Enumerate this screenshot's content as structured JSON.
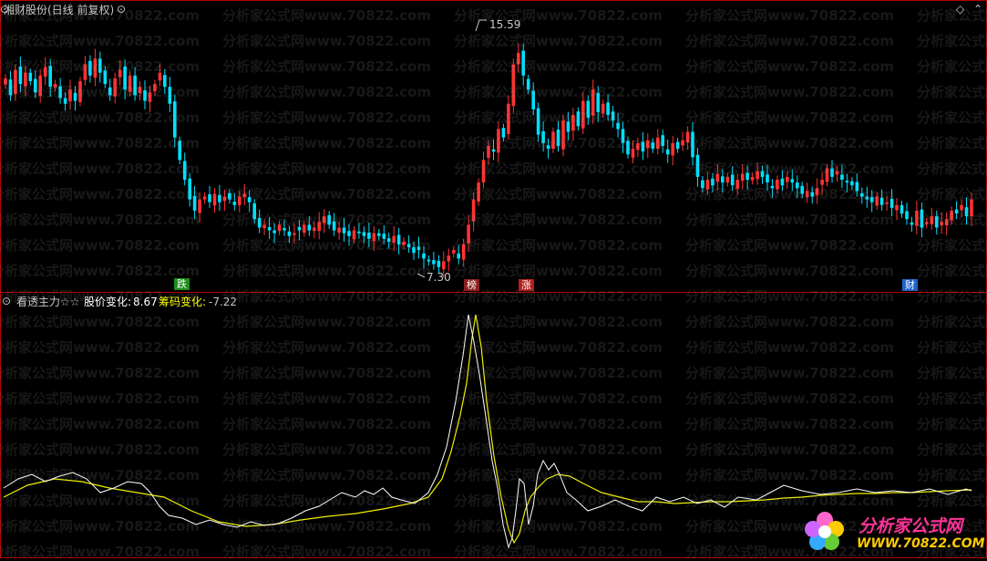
{
  "colors": {
    "up": "#ff3232",
    "down": "#00e0ff",
    "border": "#b40000",
    "white_line": "#ffffff",
    "yellow_line": "#f0f000",
    "label_yellow": "#ffff00",
    "label_gray": "#c8c8c8"
  },
  "main_panel": {
    "title": "湘财股份(日线 前复权)",
    "menu_icon": "circle-chevron-icon",
    "diamond_icon": "diamond-icon",
    "high_label": "15.59",
    "low_label": "7.30",
    "badges": [
      {
        "text": "跌",
        "bg": "#1e8c1e",
        "fg": "#ffffff"
      },
      {
        "text": "榜",
        "bg": "#8c1e1e",
        "fg": "#ffffff"
      },
      {
        "text": "涨",
        "bg": "#b41e1e",
        "fg": "#ffffff"
      },
      {
        "text": "财",
        "bg": "#1e64c8",
        "fg": "#ffffff"
      }
    ]
  },
  "indicator_panel": {
    "name": "看透主力☆☆",
    "field1_label": "股价变化:",
    "field1_value": "8.67",
    "field2_label": "筹码变化:",
    "field2_value": "-7.22"
  },
  "watermark": {
    "text": "分析家公式网www.70822.com"
  },
  "logo": {
    "title": "分析家公式网",
    "url": "WWW.70822.COM"
  },
  "chart_data": [
    {
      "type": "candlestick",
      "title": "湘财股份(日线 前复权)",
      "high_marker": 15.59,
      "low_marker": 7.3,
      "ylim": [
        7.0,
        16.3
      ],
      "close": [
        14.1,
        13.5,
        14.4,
        13.9,
        14.3,
        14.0,
        13.6,
        14.2,
        14.5,
        13.8,
        13.9,
        13.4,
        13.2,
        13.7,
        13.3,
        14.0,
        14.6,
        14.2,
        14.8,
        14.3,
        13.9,
        13.5,
        14.1,
        14.4,
        13.7,
        14.2,
        13.5,
        13.8,
        13.3,
        13.6,
        13.9,
        14.3,
        13.8,
        13.2,
        12.0,
        11.2,
        10.5,
        9.8,
        9.4,
        9.8,
        9.9,
        9.7,
        10.0,
        9.7,
        9.9,
        9.8,
        9.6,
        9.9,
        10.0,
        9.7,
        9.1,
        8.8,
        8.9,
        8.7,
        8.6,
        8.9,
        8.7,
        8.5,
        8.6,
        8.7,
        8.9,
        8.7,
        8.8,
        9.0,
        9.2,
        8.9,
        8.7,
        8.8,
        8.6,
        8.5,
        8.7,
        8.6,
        8.5,
        8.4,
        8.6,
        8.5,
        8.4,
        8.3,
        8.5,
        8.2,
        8.3,
        8.1,
        7.9,
        8.0,
        7.7,
        7.6,
        7.5,
        7.4,
        7.6,
        7.8,
        8.0,
        7.7,
        8.2,
        8.9,
        9.8,
        10.4,
        11.2,
        11.7,
        11.5,
        12.3,
        12.0,
        13.2,
        14.6,
        15.0,
        14.2,
        13.7,
        13.0,
        12.1,
        11.8,
        11.6,
        12.2,
        11.7,
        12.6,
        12.2,
        12.8,
        12.4,
        13.3,
        12.7,
        13.7,
        12.9,
        13.2,
        12.8,
        12.6,
        12.3,
        11.8,
        11.4,
        11.6,
        11.8,
        11.5,
        11.9,
        11.6,
        12.0,
        11.7,
        11.4,
        11.8,
        11.6,
        11.9,
        12.2,
        11.3,
        10.6,
        10.2,
        10.5,
        10.3,
        10.7,
        10.4,
        10.6,
        10.3,
        10.5,
        10.7,
        10.5,
        10.6,
        10.8,
        10.6,
        10.4,
        10.2,
        10.5,
        10.3,
        10.6,
        10.4,
        10.2,
        10.0,
        10.1,
        9.9,
        10.2,
        10.5,
        10.9,
        10.6,
        10.8,
        10.5,
        10.4,
        10.3,
        10.1,
        9.9,
        9.8,
        9.7,
        9.9,
        9.6,
        9.7,
        9.5,
        9.6,
        9.3,
        9.1,
        8.9,
        9.4,
        8.8,
        9.0,
        9.2,
        8.8,
        9.0,
        9.1,
        9.4,
        9.3,
        9.6,
        9.2,
        9.8
      ],
      "indicator": {
        "series": [
          {
            "name": "股价变化",
            "value": 8.67
          },
          {
            "name": "筹码变化",
            "value": -7.22
          }
        ]
      }
    }
  ]
}
